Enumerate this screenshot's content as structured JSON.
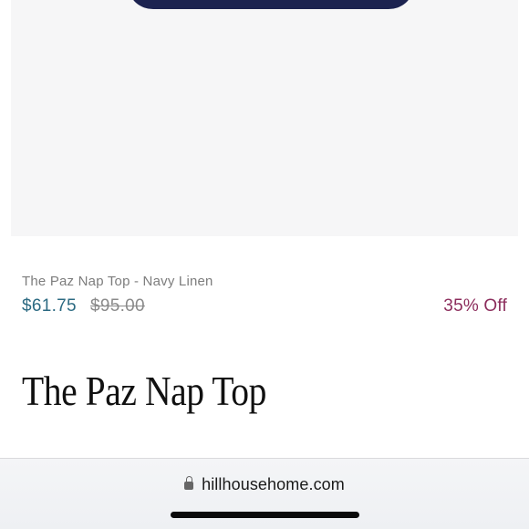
{
  "product": {
    "subtitle": "The Paz Nap Top - Navy Linen",
    "sale_price": "$61.75",
    "original_price": "$95.00",
    "discount": "35% Off",
    "title": "The Paz Nap Top"
  },
  "browser": {
    "url": "hillhousehome.com",
    "lock_icon": "lock-icon"
  },
  "colors": {
    "sale_price": "#2c6a82",
    "discount": "#8c2d5c",
    "product_navy": "#1c2350",
    "image_background": "#f6f6f7"
  }
}
